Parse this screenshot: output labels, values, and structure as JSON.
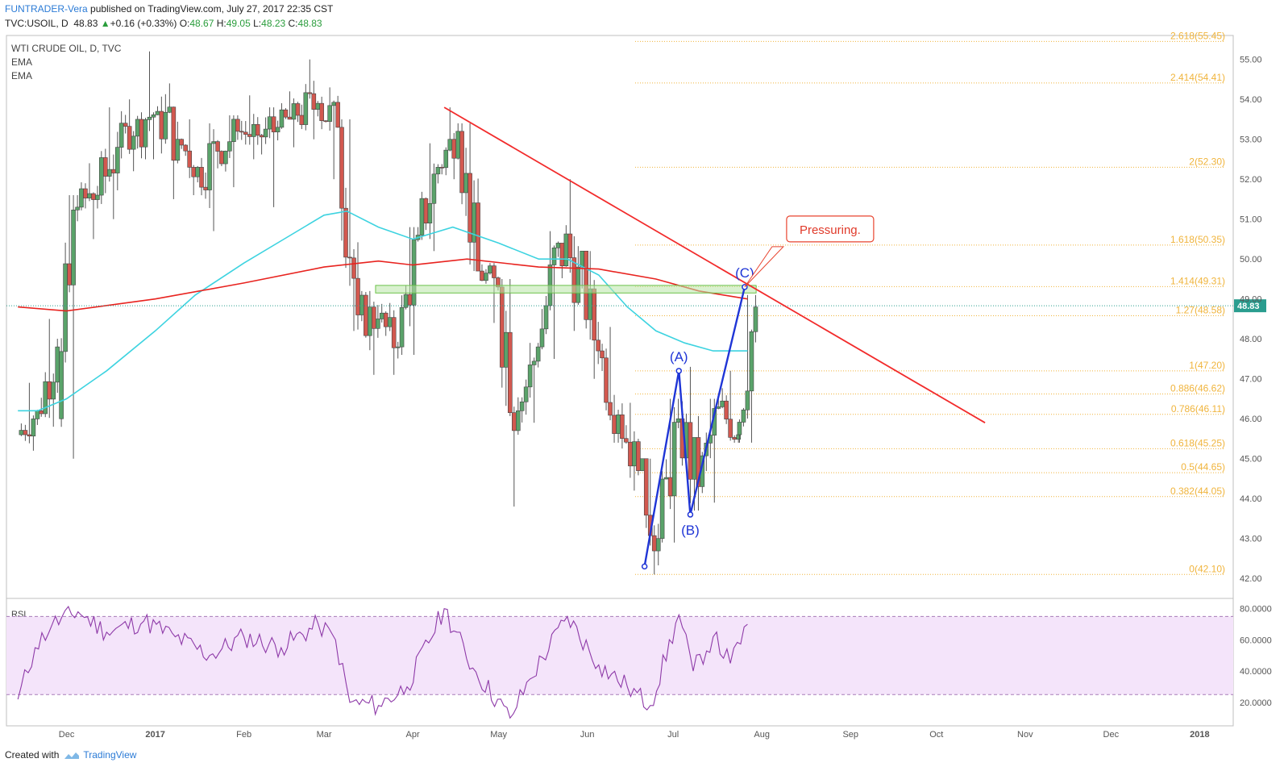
{
  "header": {
    "author": "FUNTRADER-Vera",
    "published": "published on TradingView.com, July 27, 2017 22:35 CST",
    "symbol": "TVC:USOIL, D",
    "price": "48.83",
    "change": "+0.16 (+0.33%)",
    "open_label": "O:",
    "open": "48.67",
    "high_label": "H:",
    "high": "49.05",
    "low_label": "L:",
    "low": "48.23",
    "close_label": "C:",
    "close": "48.83"
  },
  "footer": {
    "created_with": "Created with",
    "brand": "TradingView"
  },
  "colors": {
    "up": "#5aa36a",
    "down": "#d2584f",
    "ema_fast": "#3dd3e0",
    "ema_slow": "#e8231f",
    "trend": "#f22b2b",
    "abc": "#1f35d6",
    "fib": "#f0b43c",
    "rsi": "#8e3aa8"
  },
  "chart_data": [
    {
      "type": "candlestick",
      "title": "WTI CRUDE OIL, D, TVC",
      "indicators": [
        "EMA",
        "EMA"
      ],
      "ylim": [
        41.5,
        55.6
      ],
      "yticks": [
        42,
        43,
        44,
        45,
        46,
        47,
        48,
        49,
        50,
        51,
        52,
        53,
        54,
        55
      ],
      "ytick_labels": [
        "42.00",
        "43.00",
        "44.00",
        "45.00",
        "46.00",
        "47.00",
        "48.00",
        "49.00",
        "50.00",
        "51.00",
        "52.00",
        "53.00",
        "54.00",
        "55.00"
      ],
      "x_labels": [
        "Dec",
        "2017",
        "Feb",
        "Mar",
        "Apr",
        "May",
        "Jun",
        "Jul",
        "Aug",
        "Sep",
        "Oct",
        "Nov",
        "Dec",
        "2018"
      ],
      "last_price": 48.83,
      "last_price_label": "48.83",
      "fib_levels": [
        {
          "label": "2.618(55.45)",
          "value": 55.45
        },
        {
          "label": "2.414(54.41)",
          "value": 54.41
        },
        {
          "label": "2(52.30)",
          "value": 52.3
        },
        {
          "label": "1.618(50.35)",
          "value": 50.35
        },
        {
          "label": "1.414(49.31)",
          "value": 49.31
        },
        {
          "label": "1.27(48.58)",
          "value": 48.58
        },
        {
          "label": "1(47.20)",
          "value": 47.2
        },
        {
          "label": "0.886(46.62)",
          "value": 46.62
        },
        {
          "label": "0.786(46.11)",
          "value": 46.11
        },
        {
          "label": "0.618(45.25)",
          "value": 45.25
        },
        {
          "label": "0.5(44.65)",
          "value": 44.65
        },
        {
          "label": "0.382(44.05)",
          "value": 44.05
        },
        {
          "label": "0(42.10)",
          "value": 42.1
        }
      ],
      "abc_points": [
        {
          "date": "2017-06-21",
          "value": 42.3,
          "label": ""
        },
        {
          "date": "2017-07-03",
          "value": 47.2,
          "label": "(A)"
        },
        {
          "date": "2017-07-07",
          "value": 43.6,
          "label": "(B)"
        },
        {
          "date": "2017-07-26",
          "value": 49.3,
          "label": "(C)"
        }
      ],
      "trendline": [
        {
          "date": "2017-04-12",
          "value": 53.8
        },
        {
          "date": "2017-10-18",
          "value": 45.9
        }
      ],
      "resistance_zone": {
        "from": "2017-03-19",
        "to": "2017-07-30",
        "low": 49.15,
        "high": 49.3
      },
      "annotation": {
        "text": "Pressuring.",
        "date": "2017-07-26",
        "value": 49.3
      },
      "ohlc_weekly": [
        {
          "date": "2016-11-18",
          "o": 45.6,
          "h": 46.9,
          "l": 45.2,
          "c": 46.2
        },
        {
          "date": "2016-11-25",
          "o": 46.2,
          "h": 48.5,
          "l": 45.8,
          "c": 47.8
        },
        {
          "date": "2016-12-02",
          "o": 46.0,
          "h": 51.6,
          "l": 45.0,
          "c": 51.3
        },
        {
          "date": "2016-12-09",
          "o": 51.3,
          "h": 52.4,
          "l": 50.5,
          "c": 51.6
        },
        {
          "date": "2016-12-16",
          "o": 51.6,
          "h": 53.8,
          "l": 51.0,
          "c": 52.8
        },
        {
          "date": "2016-12-23",
          "o": 52.8,
          "h": 54.0,
          "l": 52.2,
          "c": 53.5
        },
        {
          "date": "2016-12-30",
          "o": 53.5,
          "h": 55.2,
          "l": 52.5,
          "c": 53.7
        },
        {
          "date": "2017-01-06",
          "o": 53.7,
          "h": 54.4,
          "l": 51.5,
          "c": 53.0
        },
        {
          "date": "2017-01-13",
          "o": 53.0,
          "h": 53.5,
          "l": 51.6,
          "c": 52.3
        },
        {
          "date": "2017-01-20",
          "o": 52.3,
          "h": 53.4,
          "l": 50.7,
          "c": 52.7
        },
        {
          "date": "2017-01-27",
          "o": 52.7,
          "h": 53.6,
          "l": 51.8,
          "c": 53.2
        },
        {
          "date": "2017-02-03",
          "o": 53.2,
          "h": 54.1,
          "l": 52.5,
          "c": 53.1
        },
        {
          "date": "2017-02-10",
          "o": 53.1,
          "h": 53.8,
          "l": 51.3,
          "c": 53.3
        },
        {
          "date": "2017-02-17",
          "o": 53.3,
          "h": 54.2,
          "l": 52.8,
          "c": 53.6
        },
        {
          "date": "2017-02-24",
          "o": 53.6,
          "h": 55.0,
          "l": 53.0,
          "c": 53.9
        },
        {
          "date": "2017-03-03",
          "o": 53.9,
          "h": 54.3,
          "l": 52.0,
          "c": 53.3
        },
        {
          "date": "2017-03-10",
          "o": 53.3,
          "h": 53.5,
          "l": 48.2,
          "c": 48.6
        },
        {
          "date": "2017-03-17",
          "o": 48.6,
          "h": 49.2,
          "l": 47.1,
          "c": 48.5
        },
        {
          "date": "2017-03-24",
          "o": 48.5,
          "h": 48.9,
          "l": 47.1,
          "c": 47.8
        },
        {
          "date": "2017-03-31",
          "o": 47.8,
          "h": 50.8,
          "l": 47.6,
          "c": 50.6
        },
        {
          "date": "2017-04-07",
          "o": 50.6,
          "h": 52.9,
          "l": 50.2,
          "c": 52.3
        },
        {
          "date": "2017-04-14",
          "o": 52.3,
          "h": 53.8,
          "l": 52.0,
          "c": 53.2
        },
        {
          "date": "2017-04-21",
          "o": 53.2,
          "h": 53.4,
          "l": 49.7,
          "c": 49.7
        },
        {
          "date": "2017-04-28",
          "o": 49.7,
          "h": 49.9,
          "l": 48.4,
          "c": 49.3
        },
        {
          "date": "2017-05-05",
          "o": 49.3,
          "h": 49.5,
          "l": 43.8,
          "c": 46.2
        },
        {
          "date": "2017-05-12",
          "o": 46.2,
          "h": 47.9,
          "l": 45.9,
          "c": 47.8
        },
        {
          "date": "2017-05-19",
          "o": 47.8,
          "h": 50.7,
          "l": 47.5,
          "c": 50.4
        },
        {
          "date": "2017-05-26",
          "o": 50.4,
          "h": 52.0,
          "l": 48.2,
          "c": 49.8
        },
        {
          "date": "2017-06-02",
          "o": 49.8,
          "h": 50.2,
          "l": 47.0,
          "c": 47.7
        },
        {
          "date": "2017-06-09",
          "o": 47.7,
          "h": 48.3,
          "l": 45.4,
          "c": 46.1
        },
        {
          "date": "2017-06-16",
          "o": 46.1,
          "h": 46.4,
          "l": 44.2,
          "c": 44.7
        },
        {
          "date": "2017-06-23",
          "o": 44.7,
          "h": 45.0,
          "l": 42.1,
          "c": 43.0
        },
        {
          "date": "2017-06-30",
          "o": 43.0,
          "h": 46.5,
          "l": 42.9,
          "c": 46.0
        },
        {
          "date": "2017-07-07",
          "o": 46.0,
          "h": 47.3,
          "l": 43.7,
          "c": 44.3
        },
        {
          "date": "2017-07-14",
          "o": 44.3,
          "h": 46.5,
          "l": 43.9,
          "c": 46.3
        },
        {
          "date": "2017-07-21",
          "o": 46.3,
          "h": 47.2,
          "l": 45.4,
          "c": 45.6
        },
        {
          "date": "2017-07-27",
          "o": 45.6,
          "h": 49.1,
          "l": 45.4,
          "c": 48.8
        }
      ],
      "ema_fast": [
        {
          "date": "2016-11-14",
          "value": 46.2
        },
        {
          "date": "2016-11-21",
          "value": 46.2
        },
        {
          "date": "2016-12-01",
          "value": 46.5
        },
        {
          "date": "2016-12-15",
          "value": 47.2
        },
        {
          "date": "2017-01-01",
          "value": 48.2
        },
        {
          "date": "2017-01-15",
          "value": 49.1
        },
        {
          "date": "2017-02-01",
          "value": 49.9
        },
        {
          "date": "2017-02-15",
          "value": 50.5
        },
        {
          "date": "2017-03-01",
          "value": 51.1
        },
        {
          "date": "2017-03-09",
          "value": 51.2
        },
        {
          "date": "2017-03-20",
          "value": 50.8
        },
        {
          "date": "2017-04-01",
          "value": 50.5
        },
        {
          "date": "2017-04-15",
          "value": 50.8
        },
        {
          "date": "2017-05-01",
          "value": 50.4
        },
        {
          "date": "2017-05-15",
          "value": 50.0
        },
        {
          "date": "2017-05-25",
          "value": 50.0
        },
        {
          "date": "2017-06-05",
          "value": 49.6
        },
        {
          "date": "2017-06-15",
          "value": 48.8
        },
        {
          "date": "2017-06-25",
          "value": 48.2
        },
        {
          "date": "2017-07-05",
          "value": 47.9
        },
        {
          "date": "2017-07-15",
          "value": 47.7
        },
        {
          "date": "2017-07-27",
          "value": 47.7
        }
      ],
      "ema_slow": [
        {
          "date": "2016-11-14",
          "value": 48.8
        },
        {
          "date": "2016-12-01",
          "value": 48.7
        },
        {
          "date": "2017-01-01",
          "value": 49.0
        },
        {
          "date": "2017-02-01",
          "value": 49.4
        },
        {
          "date": "2017-03-01",
          "value": 49.8
        },
        {
          "date": "2017-03-20",
          "value": 49.95
        },
        {
          "date": "2017-04-01",
          "value": 49.85
        },
        {
          "date": "2017-04-20",
          "value": 50.0
        },
        {
          "date": "2017-05-15",
          "value": 49.8
        },
        {
          "date": "2017-06-05",
          "value": 49.75
        },
        {
          "date": "2017-06-25",
          "value": 49.5
        },
        {
          "date": "2017-07-10",
          "value": 49.2
        },
        {
          "date": "2017-07-27",
          "value": 49.0
        }
      ]
    },
    {
      "type": "line",
      "title": "RSI",
      "ylim": [
        5,
        85
      ],
      "yticks": [
        20,
        40,
        60,
        80
      ],
      "ytick_labels": [
        "20.0000",
        "40.0000",
        "60.0000",
        "80.0000"
      ],
      "band": [
        25,
        75
      ],
      "series": [
        {
          "date": "2016-11-14",
          "value": 22
        },
        {
          "date": "2016-11-20",
          "value": 55
        },
        {
          "date": "2016-11-26",
          "value": 70
        },
        {
          "date": "2016-12-05",
          "value": 78
        },
        {
          "date": "2016-12-15",
          "value": 65
        },
        {
          "date": "2016-12-28",
          "value": 72
        },
        {
          "date": "2017-01-08",
          "value": 62
        },
        {
          "date": "2017-01-20",
          "value": 50
        },
        {
          "date": "2017-02-01",
          "value": 62
        },
        {
          "date": "2017-02-14",
          "value": 55
        },
        {
          "date": "2017-02-27",
          "value": 70
        },
        {
          "date": "2017-03-05",
          "value": 60
        },
        {
          "date": "2017-03-10",
          "value": 20
        },
        {
          "date": "2017-03-20",
          "value": 18
        },
        {
          "date": "2017-03-30",
          "value": 30
        },
        {
          "date": "2017-04-12",
          "value": 80
        },
        {
          "date": "2017-04-22",
          "value": 42
        },
        {
          "date": "2017-05-05",
          "value": 10
        },
        {
          "date": "2017-05-12",
          "value": 35
        },
        {
          "date": "2017-05-25",
          "value": 75
        },
        {
          "date": "2017-06-05",
          "value": 44
        },
        {
          "date": "2017-06-15",
          "value": 30
        },
        {
          "date": "2017-06-23",
          "value": 18
        },
        {
          "date": "2017-07-03",
          "value": 76
        },
        {
          "date": "2017-07-08",
          "value": 40
        },
        {
          "date": "2017-07-15",
          "value": 62
        },
        {
          "date": "2017-07-21",
          "value": 45
        },
        {
          "date": "2017-07-27",
          "value": 70
        }
      ]
    }
  ]
}
